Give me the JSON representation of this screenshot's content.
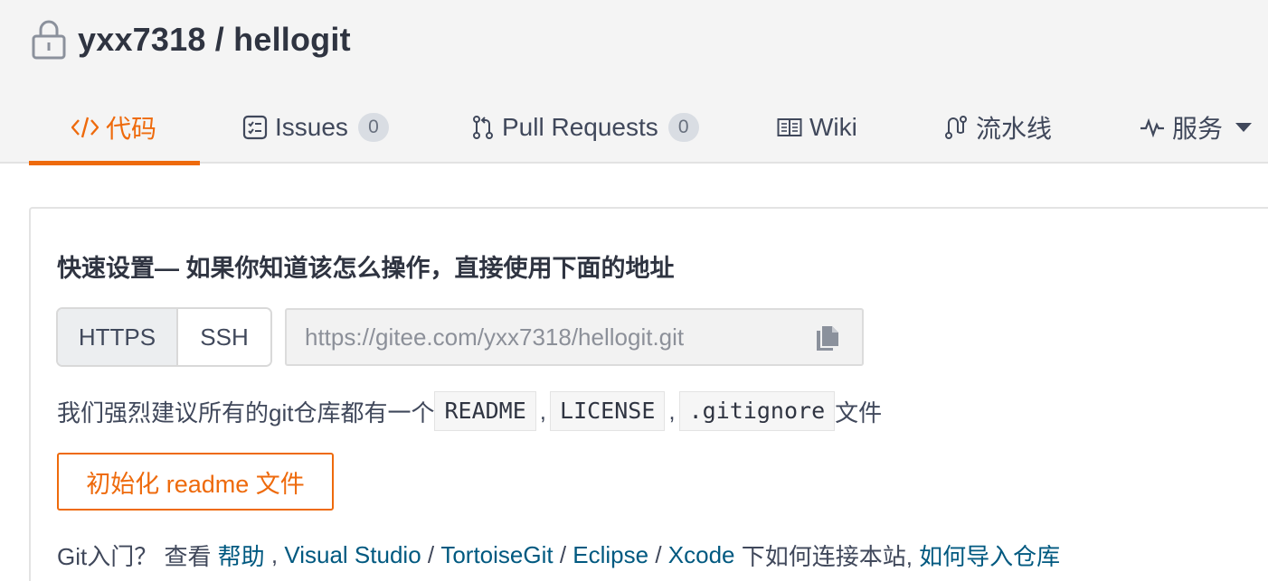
{
  "repo": {
    "owner": "yxx7318",
    "separator": " / ",
    "name": "hellogit"
  },
  "tabs": [
    {
      "label": "代码",
      "icon": "code-icon",
      "active": true
    },
    {
      "label": "Issues",
      "icon": "issues-icon",
      "badge": "0"
    },
    {
      "label": "Pull Requests",
      "icon": "pull-request-icon",
      "badge": "0"
    },
    {
      "label": "Wiki",
      "icon": "book-icon"
    },
    {
      "label": "流水线",
      "icon": "pipeline-icon"
    },
    {
      "label": "服务",
      "icon": "pulse-icon",
      "dropdown": true
    }
  ],
  "quick_setup": {
    "title": "快速设置— 如果你知道该怎么操作，直接使用下面的地址",
    "protocols": [
      "HTTPS",
      "SSH"
    ],
    "selected_protocol": "HTTPS",
    "clone_url": "https://gitee.com/yxx7318/hellogit.git",
    "recommend_prefix": "我们强烈建议所有的git仓库都有一个",
    "files": [
      "README",
      "LICENSE",
      ".gitignore"
    ],
    "file_separator": ",",
    "recommend_suffix": "文件",
    "init_button": "初始化 readme 文件"
  },
  "help": {
    "prefix": "Git入门？ 查看 ",
    "help_link": "帮助",
    "comma": " , ",
    "tools": [
      "Visual Studio",
      "TortoiseGit",
      "Eclipse",
      "Xcode"
    ],
    "tool_separator": " / ",
    "middle_text": " 下如何连接本站, ",
    "import_link": "如何导入仓库"
  },
  "colors": {
    "accent": "#ee6a0c",
    "link": "#005980",
    "text": "#40485b"
  }
}
